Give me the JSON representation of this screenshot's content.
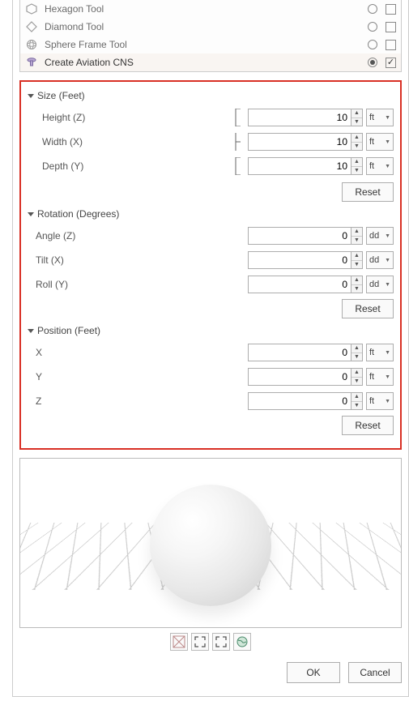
{
  "tools": [
    {
      "label": "Hexagon Tool",
      "selected": false,
      "checked": false
    },
    {
      "label": "Diamond Tool",
      "selected": false,
      "checked": false
    },
    {
      "label": "Sphere Frame Tool",
      "selected": false,
      "checked": false
    },
    {
      "label": "Create Aviation CNS",
      "selected": true,
      "checked": true
    }
  ],
  "sections": {
    "size": {
      "title": "Size (Feet)",
      "height": {
        "label": "Height (Z)",
        "value": "10",
        "unit": "ft"
      },
      "width": {
        "label": "Width (X)",
        "value": "10",
        "unit": "ft"
      },
      "depth": {
        "label": "Depth (Y)",
        "value": "10",
        "unit": "ft"
      },
      "reset": "Reset"
    },
    "rotation": {
      "title": "Rotation (Degrees)",
      "angle": {
        "label": "Angle (Z)",
        "value": "0",
        "unit": "dd"
      },
      "tilt": {
        "label": "Tilt (X)",
        "value": "0",
        "unit": "dd"
      },
      "roll": {
        "label": "Roll (Y)",
        "value": "0",
        "unit": "dd"
      },
      "reset": "Reset"
    },
    "position": {
      "title": "Position (Feet)",
      "x": {
        "label": "X",
        "value": "0",
        "unit": "ft"
      },
      "y": {
        "label": "Y",
        "value": "0",
        "unit": "ft"
      },
      "z": {
        "label": "Z",
        "value": "0",
        "unit": "ft"
      },
      "reset": "Reset"
    }
  },
  "buttons": {
    "ok": "OK",
    "cancel": "Cancel"
  }
}
